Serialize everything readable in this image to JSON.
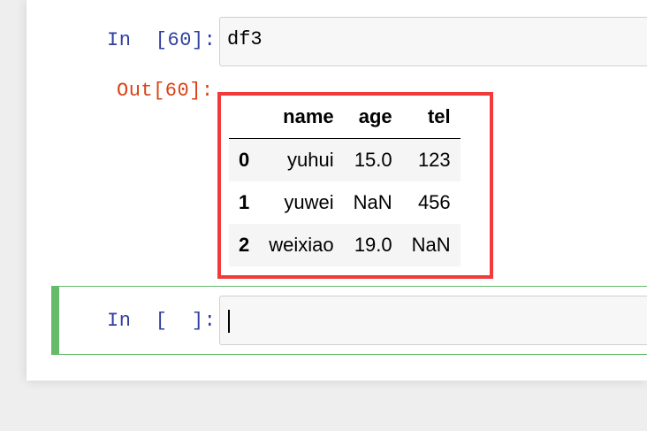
{
  "cell1": {
    "in_prompt": "In  [60]:",
    "code": "df3",
    "out_prompt": "Out[60]:"
  },
  "dataframe": {
    "columns": [
      "",
      "name",
      "age",
      "tel"
    ],
    "rows": [
      {
        "index": "0",
        "name": "yuhui",
        "age": "15.0",
        "tel": "123"
      },
      {
        "index": "1",
        "name": "yuwei",
        "age": "NaN",
        "tel": "456"
      },
      {
        "index": "2",
        "name": "weixiao",
        "age": "19.0",
        "tel": "NaN"
      }
    ]
  },
  "cell2": {
    "in_prompt": "In  [  ]:",
    "code": ""
  },
  "colors": {
    "in_prompt": "#303f9f",
    "out_prompt": "#d84315",
    "highlight_box": "#f23a3a",
    "active_cell_bar": "#66bb6a"
  }
}
